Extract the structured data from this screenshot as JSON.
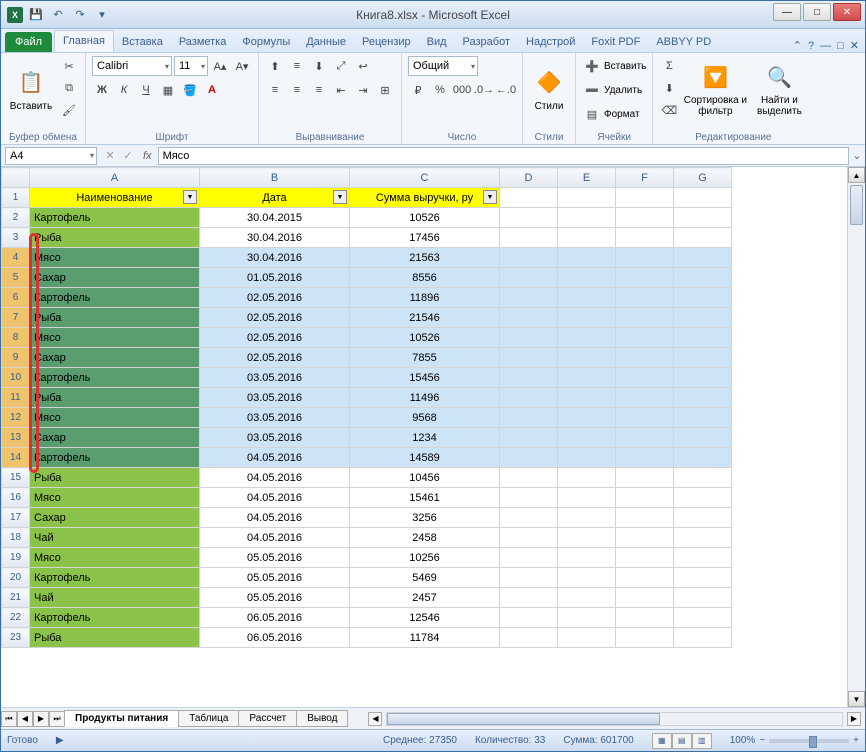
{
  "app": {
    "title": "Книга8.xlsx - Microsoft Excel"
  },
  "qat": {
    "save_tip": "Сохранить",
    "undo_tip": "Отменить",
    "redo_tip": "Вернуть"
  },
  "tabs": {
    "file": "Файл",
    "items": [
      "Главная",
      "Вставка",
      "Разметка",
      "Формулы",
      "Данные",
      "Рецензир",
      "Вид",
      "Разработ",
      "Надстрой",
      "Foxit PDF",
      "ABBYY PD"
    ],
    "active": 0
  },
  "ribbon": {
    "clipboard": {
      "label": "Буфер обмена",
      "paste": "Вставить"
    },
    "font": {
      "label": "Шрифт",
      "name": "Calibri",
      "size": "11"
    },
    "align": {
      "label": "Выравнивание"
    },
    "number": {
      "label": "Число",
      "format": "Общий"
    },
    "styles": {
      "label": "Стили",
      "btn": "Стили"
    },
    "cells": {
      "label": "Ячейки",
      "insert": "Вставить",
      "delete": "Удалить",
      "format": "Формат"
    },
    "editing": {
      "label": "Редактирование",
      "sort": "Сортировка и фильтр",
      "find": "Найти и выделить"
    }
  },
  "formula_bar": {
    "name": "A4",
    "fx": "fx",
    "value": "Мясо"
  },
  "columns": [
    "A",
    "B",
    "C",
    "D",
    "E",
    "F",
    "G"
  ],
  "headers": {
    "A": "Наименование",
    "B": "Дата",
    "C": "Сумма выручки, ру"
  },
  "rows": [
    {
      "r": 2,
      "a": "Картофель",
      "b": "30.04.2015",
      "c": "10526",
      "sel": false
    },
    {
      "r": 3,
      "a": "Рыба",
      "b": "30.04.2016",
      "c": "17456",
      "sel": false
    },
    {
      "r": 4,
      "a": "Мясо",
      "b": "30.04.2016",
      "c": "21563",
      "sel": true
    },
    {
      "r": 5,
      "a": "Сахар",
      "b": "01.05.2016",
      "c": "8556",
      "sel": true
    },
    {
      "r": 6,
      "a": "Картофель",
      "b": "02.05.2016",
      "c": "11896",
      "sel": true
    },
    {
      "r": 7,
      "a": "Рыба",
      "b": "02.05.2016",
      "c": "21546",
      "sel": true
    },
    {
      "r": 8,
      "a": "Мясо",
      "b": "02.05.2016",
      "c": "10526",
      "sel": true
    },
    {
      "r": 9,
      "a": "Сахар",
      "b": "02.05.2016",
      "c": "7855",
      "sel": true
    },
    {
      "r": 10,
      "a": "Картофель",
      "b": "03.05.2016",
      "c": "15456",
      "sel": true
    },
    {
      "r": 11,
      "a": "Рыба",
      "b": "03.05.2016",
      "c": "11496",
      "sel": true
    },
    {
      "r": 12,
      "a": "Мясо",
      "b": "03.05.2016",
      "c": "9568",
      "sel": true
    },
    {
      "r": 13,
      "a": "Сахар",
      "b": "03.05.2016",
      "c": "1234",
      "sel": true
    },
    {
      "r": 14,
      "a": "Картофель",
      "b": "04.05.2016",
      "c": "14589",
      "sel": true
    },
    {
      "r": 15,
      "a": "Рыба",
      "b": "04.05.2016",
      "c": "10456",
      "sel": false
    },
    {
      "r": 16,
      "a": "Мясо",
      "b": "04.05.2016",
      "c": "15461",
      "sel": false
    },
    {
      "r": 17,
      "a": "Сахар",
      "b": "04.05.2016",
      "c": "3256",
      "sel": false
    },
    {
      "r": 18,
      "a": "Чай",
      "b": "04.05.2016",
      "c": "2458",
      "sel": false
    },
    {
      "r": 19,
      "a": "Мясо",
      "b": "05.05.2016",
      "c": "10256",
      "sel": false
    },
    {
      "r": 20,
      "a": "Картофель",
      "b": "05.05.2016",
      "c": "5469",
      "sel": false
    },
    {
      "r": 21,
      "a": "Чай",
      "b": "05.05.2016",
      "c": "2457",
      "sel": false
    },
    {
      "r": 22,
      "a": "Картофель",
      "b": "06.05.2016",
      "c": "12546",
      "sel": false
    },
    {
      "r": 23,
      "a": "Рыба",
      "b": "06.05.2016",
      "c": "11784",
      "sel": false
    }
  ],
  "sheets": {
    "items": [
      "Продукты питания",
      "Таблица",
      "Рассчет",
      "Вывод"
    ],
    "active": 0
  },
  "status": {
    "ready": "Готово",
    "avg_label": "Среднее:",
    "avg": "27350",
    "count_label": "Количество:",
    "count": "33",
    "sum_label": "Сумма:",
    "sum": "601700",
    "zoom": "100%"
  },
  "winbtns": {
    "min": "—",
    "max": "□",
    "close": "✕"
  }
}
